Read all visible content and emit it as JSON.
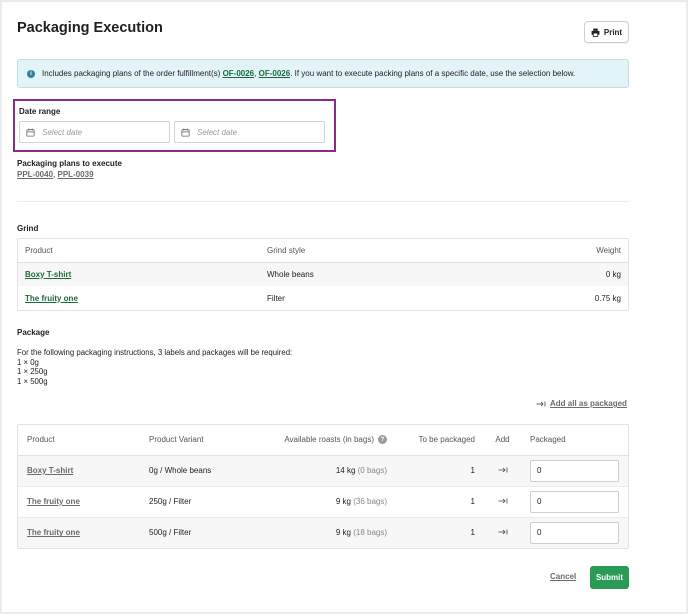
{
  "header": {
    "title": "Packaging Execution",
    "print_label": "Print"
  },
  "info": {
    "prefix": "Includes packaging plans of the order fulfillment(s)",
    "order1": "OF-0026",
    "sep": ",",
    "order2": "OF-0026",
    "suffix": ". If you want to execute packing plans of a specific date, use the selection below."
  },
  "date_range": {
    "label": "Date range",
    "start_placeholder": "Select date",
    "end_placeholder": "Select date"
  },
  "plans": {
    "label": "Packaging plans to execute",
    "plan1": "PPL-0040",
    "sep": ",",
    "plan2": "PPL-0039"
  },
  "grind": {
    "heading": "Grind",
    "columns": [
      "Product",
      "Grind style",
      "Weight"
    ],
    "rows": [
      {
        "product": "Boxy T-shirt",
        "style": "Whole beans",
        "weight": "0 kg"
      },
      {
        "product": "The fruity one",
        "style": "Filter",
        "weight": "0.75 kg"
      }
    ]
  },
  "package": {
    "heading": "Package",
    "instructions": "For the following packaging instructions, 3 labels and packages will be required:",
    "lines": [
      "1 × 0g",
      "1 × 250g",
      "1 × 500g"
    ],
    "add_all_label": "Add all as packaged",
    "columns": [
      "Product",
      "Product Variant",
      "Available roasts (in bags)",
      "To be packaged",
      "Add",
      "Packaged"
    ],
    "rows": [
      {
        "product": "Boxy T-shirt",
        "variant": "0g / Whole beans",
        "kg": "14 kg",
        "bags": "(0 bags)",
        "to_package": "1",
        "packaged": "0"
      },
      {
        "product": "The fruity one",
        "variant": "250g / Filter",
        "kg": "9 kg",
        "bags": "(36 bags)",
        "to_package": "1",
        "packaged": "0"
      },
      {
        "product": "The fruity one",
        "variant": "500g / Filter",
        "kg": "9 kg",
        "bags": "(18 bags)",
        "to_package": "1",
        "packaged": "0"
      }
    ]
  },
  "footer": {
    "cancel_label": "Cancel",
    "submit_label": "Submit"
  },
  "colors": {
    "accent_green": "#2b9a55",
    "link_green": "#1b6b3a",
    "info_bg": "#e3f4f8",
    "highlight_border": "#8a2a8a"
  },
  "icons": {
    "print": "printer-icon",
    "info": "info-icon",
    "calendar": "calendar-icon",
    "help": "question-icon",
    "add": "arrow-to-line-icon"
  }
}
